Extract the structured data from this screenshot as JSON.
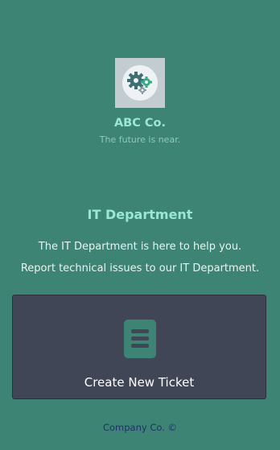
{
  "brand": {
    "name": "ABC Co.",
    "tagline": "The future is near.",
    "logo_icon": "gears-icon"
  },
  "department": {
    "title": "IT Department",
    "intro_line1": "The IT Department is here to help you.",
    "intro_line2": "Report technical issues to our IT Department."
  },
  "ticket": {
    "label": "Create New Ticket",
    "icon": "ticket-list-icon"
  },
  "footer": {
    "text": "Company Co. ©"
  },
  "colors": {
    "background": "#3e8475",
    "accent_text": "#9be7d3",
    "card": "#404656",
    "footer_text": "#1f2f6e"
  }
}
